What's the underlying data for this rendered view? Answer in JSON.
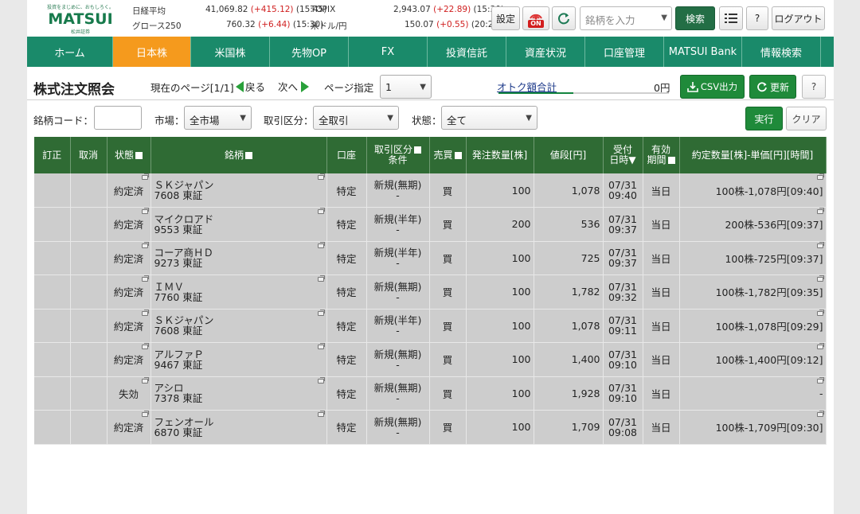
{
  "header": {
    "logo_tagline": "投資をまじめに、おもしろく。",
    "logo_name": "MATSUI",
    "logo_sub": "松井証券",
    "market": [
      {
        "label": "日経平均",
        "value": "41,069.82",
        "change": "(+415.12)",
        "time": "(15:45)"
      },
      {
        "label": "グロース250",
        "value": "760.32",
        "change": "(+6.44)",
        "time": "(15:30)"
      },
      {
        "label": "TOPIX",
        "value": "2,943.07",
        "change": "(+22.89)",
        "time": "(15:30)"
      },
      {
        "label": "米ドル/円",
        "value": "150.07",
        "change": "(+0.55)",
        "time": "(20:26)"
      }
    ],
    "settings_label": "設定",
    "on_label": "ON",
    "search_placeholder": "銘柄を入力",
    "search_button": "検索",
    "help_label": "?",
    "logout_label": "ログアウト"
  },
  "nav": [
    {
      "label": "ホーム",
      "active": false
    },
    {
      "label": "日本株",
      "active": true
    },
    {
      "label": "米国株",
      "active": false
    },
    {
      "label": "先物OP",
      "active": false
    },
    {
      "label": "FX",
      "active": false
    },
    {
      "label": "投資信託",
      "active": false
    },
    {
      "label": "資産状況",
      "active": false
    },
    {
      "label": "口座管理",
      "active": false
    },
    {
      "label": "MATSUI Bank",
      "active": false
    },
    {
      "label": "情報検索",
      "active": false
    }
  ],
  "page": {
    "title": "株式注文照会",
    "current_page": "現在のページ[1/1]",
    "prev": "戻る",
    "next": "次へ",
    "page_select_label": "ページ指定",
    "page_select_value": "1",
    "otoku_label": "オトク額合計",
    "otoku_value": "0円",
    "csv_label": "CSV出力",
    "refresh_label": "更新",
    "help_label": "?"
  },
  "filters": {
    "code_label": "銘柄コード：",
    "code_value": "",
    "market_label": "市場：",
    "market_value": "全市場",
    "trade_label": "取引区分：",
    "trade_value": "全取引",
    "status_label": "状態：",
    "status_value": "全て",
    "exec_label": "実行",
    "clear_label": "クリア"
  },
  "table": {
    "headers": {
      "correct": "訂正",
      "cancel": "取消",
      "status": "状態",
      "name": "銘柄",
      "account": "口座",
      "trade_1": "取引区分",
      "trade_2": "条件",
      "side": "売買",
      "qty": "発注数量[株]",
      "price": "値段[円]",
      "recv_1": "受付",
      "recv_2": "日時▼",
      "valid_1": "有効",
      "valid_2": "期間",
      "exec": "約定数量[株]-単価[円][時間]"
    },
    "rows": [
      {
        "status": "約定済",
        "name": "ＳＫジャパン",
        "code": "7608 東証",
        "account": "特定",
        "trade": "新規(無期)",
        "cond": "-",
        "side": "買",
        "qty": "100",
        "price": "1,078",
        "date": "07/31",
        "time": "09:40",
        "valid": "当日",
        "exec": "100株-1,078円[09:40]"
      },
      {
        "status": "約定済",
        "name": "マイクロアド",
        "code": "9553 東証",
        "account": "特定",
        "trade": "新規(半年)",
        "cond": "-",
        "side": "買",
        "qty": "200",
        "price": "536",
        "date": "07/31",
        "time": "09:37",
        "valid": "当日",
        "exec": "200株-536円[09:37]"
      },
      {
        "status": "約定済",
        "name": "コーア商ＨＤ",
        "code": "9273 東証",
        "account": "特定",
        "trade": "新規(半年)",
        "cond": "-",
        "side": "買",
        "qty": "100",
        "price": "725",
        "date": "07/31",
        "time": "09:37",
        "valid": "当日",
        "exec": "100株-725円[09:37]"
      },
      {
        "status": "約定済",
        "name": "ＩＭＶ",
        "code": "7760 東証",
        "account": "特定",
        "trade": "新規(無期)",
        "cond": "-",
        "side": "買",
        "qty": "100",
        "price": "1,782",
        "date": "07/31",
        "time": "09:32",
        "valid": "当日",
        "exec": "100株-1,782円[09:35]"
      },
      {
        "status": "約定済",
        "name": "ＳＫジャパン",
        "code": "7608 東証",
        "account": "特定",
        "trade": "新規(半年)",
        "cond": "-",
        "side": "買",
        "qty": "100",
        "price": "1,078",
        "date": "07/31",
        "time": "09:11",
        "valid": "当日",
        "exec": "100株-1,078円[09:29]"
      },
      {
        "status": "約定済",
        "name": "アルファＰ",
        "code": "9467 東証",
        "account": "特定",
        "trade": "新規(無期)",
        "cond": "-",
        "side": "買",
        "qty": "100",
        "price": "1,400",
        "date": "07/31",
        "time": "09:10",
        "valid": "当日",
        "exec": "100株-1,400円[09:12]"
      },
      {
        "status": "失効",
        "name": "アシロ",
        "code": "7378 東証",
        "account": "特定",
        "trade": "新規(無期)",
        "cond": "-",
        "side": "買",
        "qty": "100",
        "price": "1,928",
        "date": "07/31",
        "time": "09:10",
        "valid": "当日",
        "exec": "-"
      },
      {
        "status": "約定済",
        "name": "フェンオール",
        "code": "6870 東証",
        "account": "特定",
        "trade": "新規(無期)",
        "cond": "-",
        "side": "買",
        "qty": "100",
        "price": "1,709",
        "date": "07/31",
        "time": "09:08",
        "valid": "当日",
        "exec": "100株-1,709円[09:30]"
      }
    ]
  }
}
